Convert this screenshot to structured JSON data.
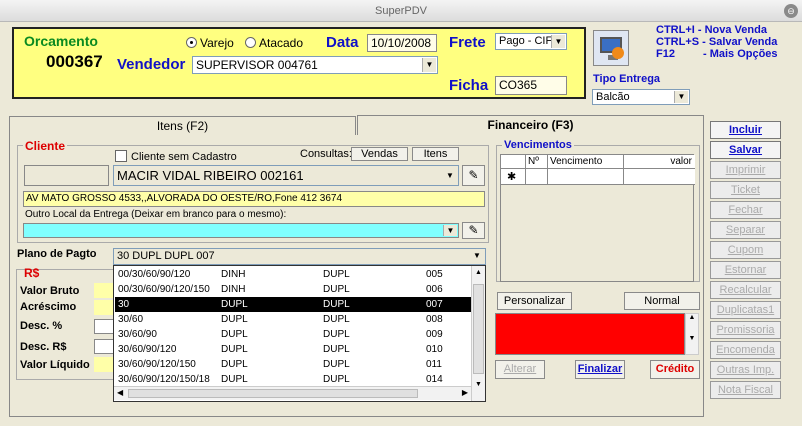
{
  "window": {
    "title": "SuperPDV",
    "close": "⊖"
  },
  "header": {
    "orcamento_label": "Orcamento",
    "orcamento_number": "000367",
    "varejo": "Varejo",
    "atacado": "Atacado",
    "data_label": "Data",
    "data_value": "10/10/2008",
    "frete_label": "Frete",
    "frete_value": "Pago - CIF",
    "vendedor_label": "Vendedor",
    "vendedor_value": "SUPERVISOR  004761",
    "ficha_label": "Ficha",
    "ficha_value": "CO365"
  },
  "shortcuts": {
    "k1": "CTRL+I",
    "a1": "- Nova Venda",
    "k2": "CTRL+S",
    "a2": "- Salvar Venda",
    "k3": "F12",
    "a3": "- Mais Opções"
  },
  "tipo_entrega": {
    "label": "Tipo Entrega",
    "value": "Balcão"
  },
  "tabs": {
    "itens": "Itens (F2)",
    "financeiro": "Financeiro (F3)"
  },
  "cliente": {
    "title": "Cliente",
    "sem_cadastro": "Cliente sem Cadastro",
    "consultas": "Consultas:",
    "vendas_btn": "Vendas",
    "itens_btn": "Itens",
    "nome": "MACIR VIDAL RIBEIRO   002161",
    "endereco": "AV MATO GROSSO 4533,,ALVORADA DO OESTE/RO,Fone 412 3674",
    "outro_local": "Outro Local da Entrega (Deixar em branco para o mesmo):"
  },
  "plano": {
    "label": "Plano de Pagto",
    "value": "30  DUPL  DUPL  007",
    "options": [
      [
        "00/30/60/90/120",
        "DINH",
        "DUPL",
        "005"
      ],
      [
        "00/30/60/90/120/150",
        "DINH",
        "DUPL",
        "006"
      ],
      [
        "30",
        "DUPL",
        "DUPL",
        "007"
      ],
      [
        "30/60",
        "DUPL",
        "DUPL",
        "008"
      ],
      [
        "30/60/90",
        "DUPL",
        "DUPL",
        "009"
      ],
      [
        "30/60/90/120",
        "DUPL",
        "DUPL",
        "010"
      ],
      [
        "30/60/90/120/150",
        "DUPL",
        "DUPL",
        "011"
      ],
      [
        "30/60/90/120/150/18",
        "DUPL",
        "DUPL",
        "014"
      ]
    ]
  },
  "valores": {
    "title": "R$",
    "bruto": "Valor Bruto",
    "acrescimo": "Acréscimo",
    "desc_pct": "Desc. %",
    "desc_rs": "Desc. R$",
    "liquido": "Valor Líquido"
  },
  "vencimentos": {
    "title": "Vencimentos",
    "cols": [
      "Nº",
      "Vencimento",
      "valor"
    ],
    "new_row": "✱"
  },
  "buttons": {
    "personalizar": "Personalizar",
    "normal": "Normal",
    "alterar": "Alterar",
    "finalizar": "Finalizar",
    "credito": "Crédito"
  },
  "side_buttons": [
    {
      "label": "Incluir",
      "enabled": true
    },
    {
      "label": "Salvar",
      "enabled": true
    },
    {
      "label": "Imprimir",
      "enabled": false
    },
    {
      "label": "Ticket",
      "enabled": false
    },
    {
      "label": "Fechar",
      "enabled": false
    },
    {
      "label": "Separar",
      "enabled": false
    },
    {
      "label": "Cupom",
      "enabled": false
    },
    {
      "label": "Estornar",
      "enabled": false
    },
    {
      "label": "Recalcular",
      "enabled": false
    },
    {
      "label": "Duplicatas1",
      "enabled": false
    },
    {
      "label": "Promissoria",
      "enabled": false
    },
    {
      "label": "Encomenda",
      "enabled": false
    },
    {
      "label": "Outras Imp.",
      "enabled": false
    },
    {
      "label": "Nota Fiscal",
      "enabled": false
    }
  ],
  "colors": {
    "header_bg": "#ffff80",
    "alert": "#ff0000",
    "accent": "#1010c8"
  }
}
